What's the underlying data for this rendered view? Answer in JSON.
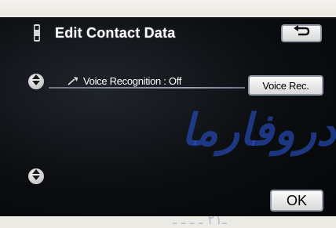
{
  "header": {
    "title": "Edit Contact Data",
    "back_icon": "return-arrow-icon",
    "phone_icon": "phone-handset-icon"
  },
  "voice_recognition": {
    "status_text": "Voice Recognition : Off",
    "status_icon": "voice-recognition-icon",
    "button_label": "Voice Rec."
  },
  "scroll": {
    "up_icon": "scroll-up-icon",
    "down_icon": "scroll-down-icon"
  },
  "footer": {
    "ok_label": "OK"
  },
  "watermark": {
    "text": "دروفارما",
    "bottom_text": "ـ۲۱ ـ ـ ـ ـ"
  },
  "colors": {
    "screen_background": "#0b0d10",
    "title_text": "#ffffff",
    "button_face": "#ececec",
    "button_border": "#8e96a6",
    "watermark": "#2850c8"
  }
}
